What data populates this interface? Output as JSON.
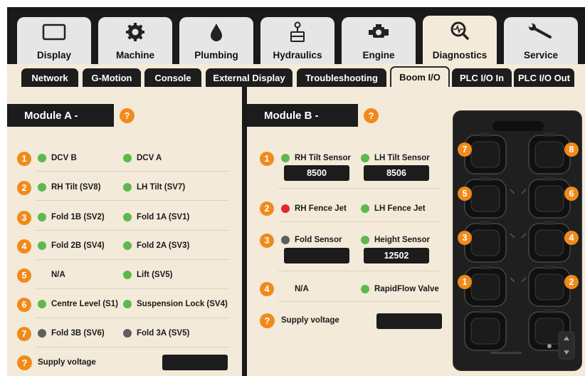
{
  "main_tabs": [
    {
      "label": "Display",
      "icon": "display-icon"
    },
    {
      "label": "Machine",
      "icon": "gear-icon"
    },
    {
      "label": "Plumbing",
      "icon": "droplet-icon"
    },
    {
      "label": "Hydraulics",
      "icon": "joystick-icon"
    },
    {
      "label": "Engine",
      "icon": "engine-icon"
    },
    {
      "label": "Diagnostics",
      "icon": "diagnostics-icon",
      "active": true
    },
    {
      "label": "Service",
      "icon": "wrench-icon"
    }
  ],
  "sub_tabs": [
    {
      "label": "Network"
    },
    {
      "label": "G-Motion"
    },
    {
      "label": "Console"
    },
    {
      "label": "External Display"
    },
    {
      "label": "Troubleshooting"
    },
    {
      "label": "Boom I/O",
      "active": true
    },
    {
      "label": "PLC I/O In"
    },
    {
      "label": "PLC I/O Out"
    }
  ],
  "help_glyph": "?",
  "module_a": {
    "title": "Module A -",
    "rows": [
      {
        "num": "1",
        "left": {
          "label": "DCV B",
          "status": "green"
        },
        "right": {
          "label": "DCV A",
          "status": "green"
        }
      },
      {
        "num": "2",
        "left": {
          "label": "RH Tilt (SV8)",
          "status": "green"
        },
        "right": {
          "label": "LH Tilt (SV7)",
          "status": "green"
        }
      },
      {
        "num": "3",
        "left": {
          "label": "Fold 1B (SV2)",
          "status": "green"
        },
        "right": {
          "label": "Fold 1A (SV1)",
          "status": "green"
        }
      },
      {
        "num": "4",
        "left": {
          "label": "Fold 2B (SV4)",
          "status": "green"
        },
        "right": {
          "label": "Fold 2A (SV3)",
          "status": "green"
        }
      },
      {
        "num": "5",
        "left": {
          "label": "N/A",
          "status": "none"
        },
        "right": {
          "label": "Lift (SV5)",
          "status": "green"
        }
      },
      {
        "num": "6",
        "left": {
          "label": "Centre Level (S1)",
          "status": "green"
        },
        "right": {
          "label": "Suspension Lock (SV4)",
          "status": "green"
        }
      },
      {
        "num": "7",
        "left": {
          "label": "Fold 3B (SV6)",
          "status": "gray"
        },
        "right": {
          "label": "Fold 3A (SV5)",
          "status": "gray"
        }
      }
    ],
    "supply_voltage_label": "Supply voltage",
    "supply_voltage_value": ""
  },
  "module_b": {
    "title": "Module B -",
    "rows": [
      {
        "num": "1",
        "left": {
          "label": "RH Tilt Sensor",
          "status": "green",
          "value": "8500"
        },
        "right": {
          "label": "LH Tilt Sensor",
          "status": "green",
          "value": "8506"
        }
      },
      {
        "num": "2",
        "left": {
          "label": "RH Fence Jet",
          "status": "red"
        },
        "right": {
          "label": "LH Fence Jet",
          "status": "green"
        }
      },
      {
        "num": "3",
        "left": {
          "label": "Fold Sensor",
          "status": "gray",
          "value": ""
        },
        "right": {
          "label": "Height Sensor",
          "status": "green",
          "value": "12502"
        }
      },
      {
        "num": "4",
        "left": {
          "label": "N/A",
          "status": "none"
        },
        "right": {
          "label": "RapidFlow Valve",
          "status": "green"
        }
      }
    ],
    "supply_voltage_label": "Supply voltage",
    "supply_voltage_value": ""
  },
  "connector": {
    "pins_left": [
      "7",
      "5",
      "3",
      "1"
    ],
    "pins_right": [
      "8",
      "6",
      "4",
      "2"
    ]
  },
  "colors": {
    "accent_orange": "#f08a1c",
    "status_green": "#5cb94e",
    "status_gray": "#5e5e5e",
    "status_red": "#e5262a",
    "panel_bg": "#f3ead9",
    "dark": "#1c1c1c"
  }
}
